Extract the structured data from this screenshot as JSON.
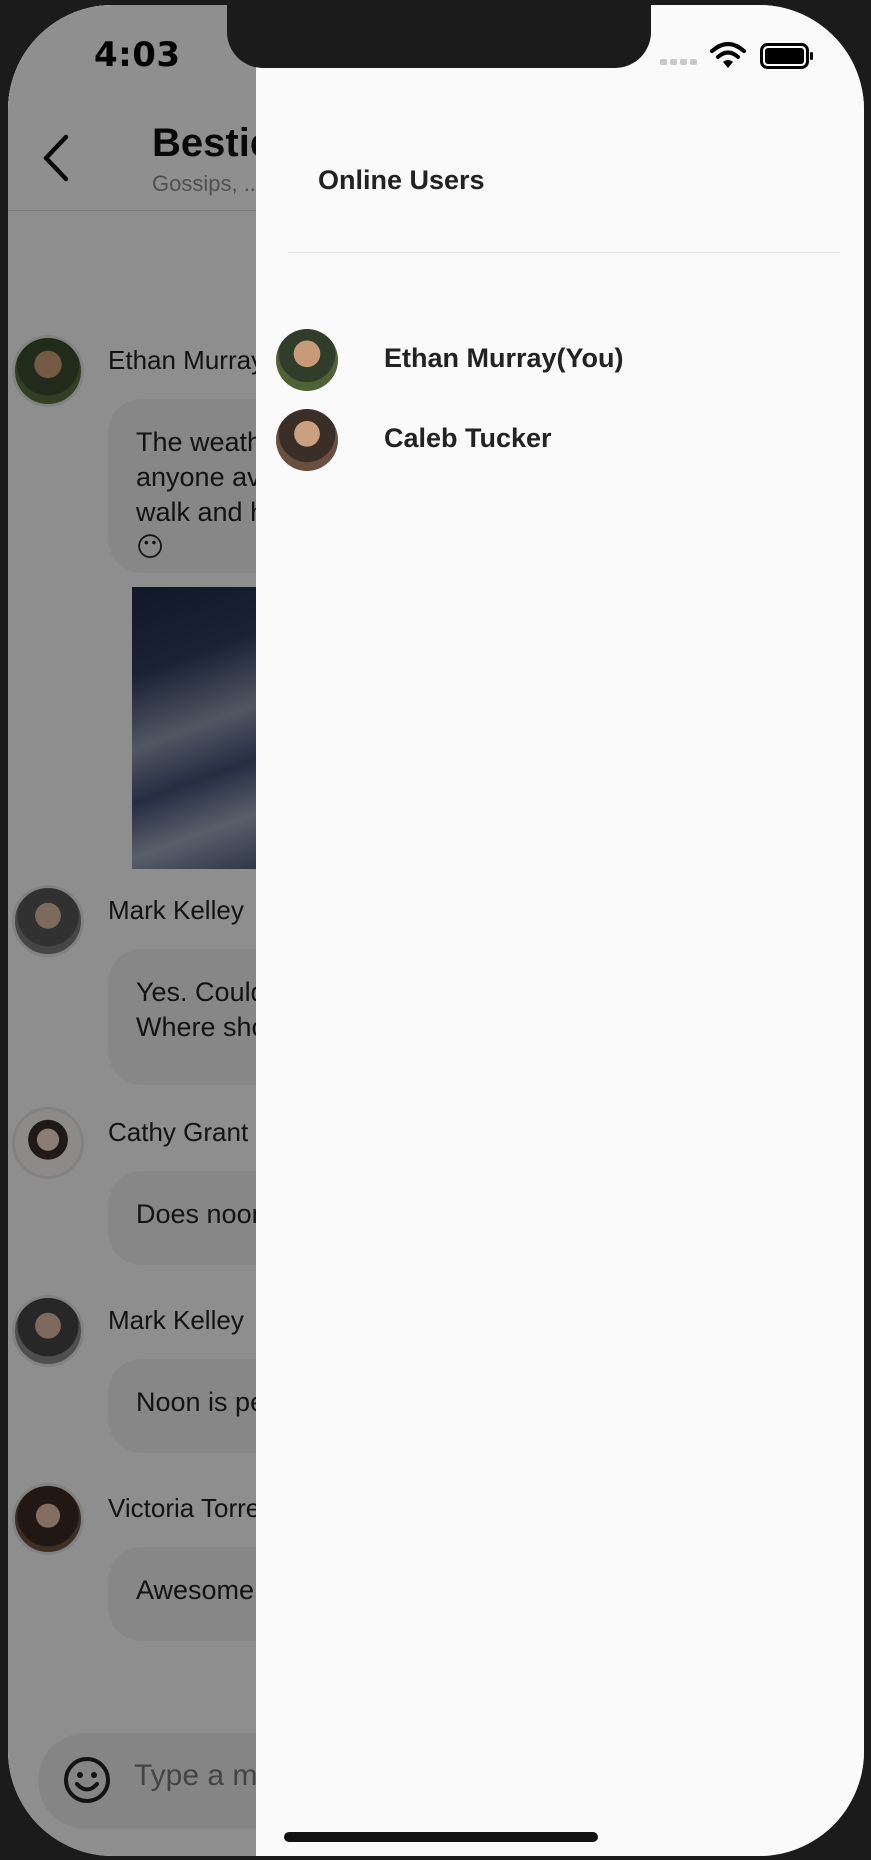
{
  "status_bar": {
    "time": "4:03"
  },
  "chat": {
    "title": "Besties",
    "subtitle": "Gossips, ...",
    "messages": [
      {
        "sender": "Ethan Murray",
        "text": "The weather is nice today. Is anyone available to go for a walk and have lunch at Diner? 😶"
      },
      {
        "sender": "Mark Kelley",
        "text": "Yes. Could we meet at noon? Where should we meet?"
      },
      {
        "sender": "Cathy Grant",
        "text": "Does noon work?"
      },
      {
        "sender": "Mark Kelley",
        "text": "Noon is perfect"
      },
      {
        "sender": "Victoria Torres",
        "text": "Awesome!"
      }
    ],
    "composer": {
      "placeholder": "Type a message"
    }
  },
  "drawer": {
    "title": "Online Users",
    "users": [
      {
        "name": "Ethan Murray(You)"
      },
      {
        "name": "Caleb Tucker"
      }
    ]
  },
  "colors": {
    "drawer_bg": "#fafafa",
    "overlay": "rgba(0,0,0,0.42)",
    "bubble": "#e8e8e8"
  },
  "icons": [
    "back-chevron-icon",
    "emoji-icon",
    "wifi-icon",
    "battery-icon",
    "signal-icon"
  ]
}
